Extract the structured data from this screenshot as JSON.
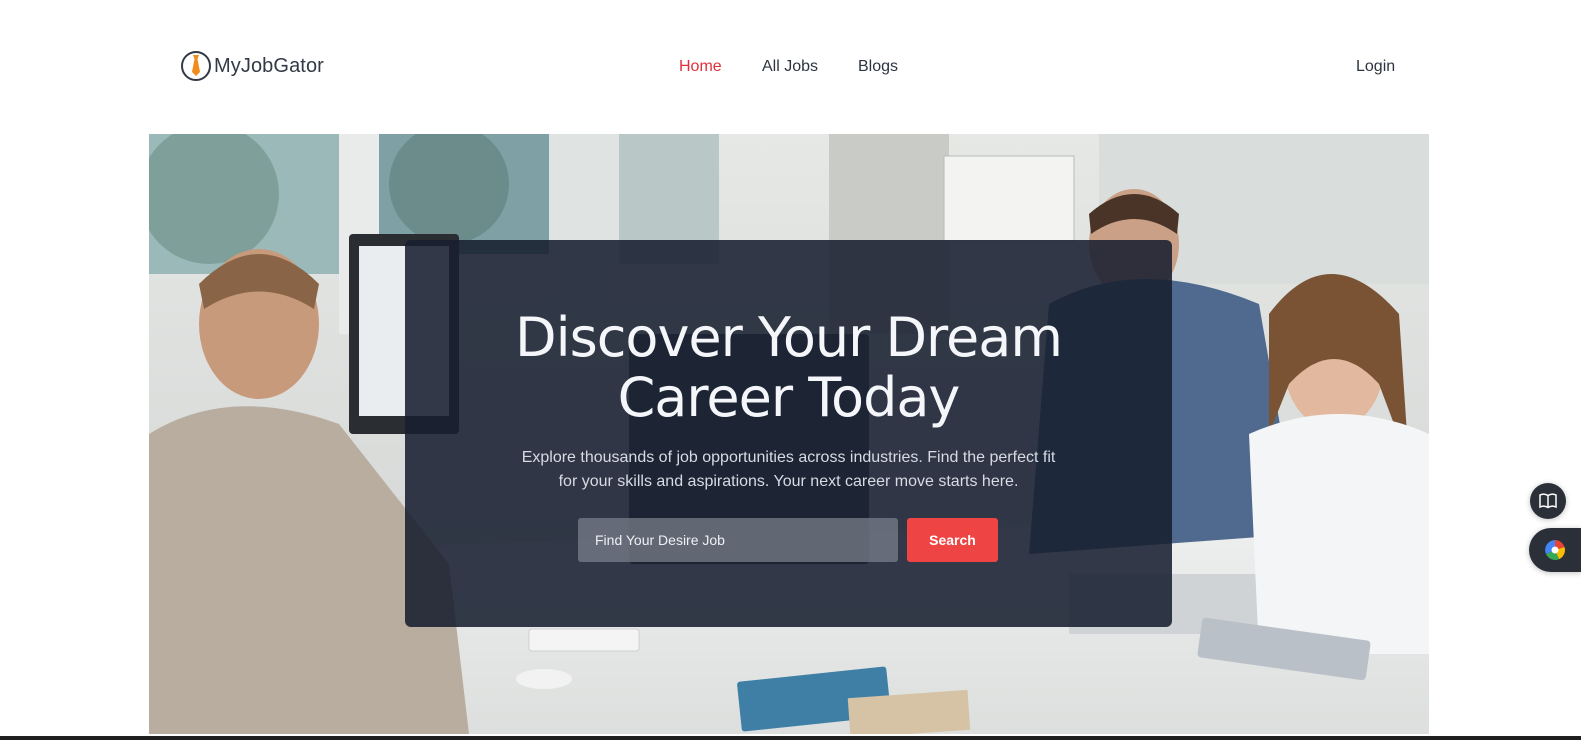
{
  "brand": {
    "name": "MyJobGator",
    "accent": "#e0313a"
  },
  "nav": {
    "items": [
      {
        "label": "Home",
        "active": true
      },
      {
        "label": "All Jobs",
        "active": false
      },
      {
        "label": "Blogs",
        "active": false
      }
    ],
    "login_label": "Login"
  },
  "hero": {
    "headline_line1": "Discover Your Dream",
    "headline_line2": "Career Today",
    "subtext_line1": "Explore thousands of job opportunities across industries. Find the perfect fit",
    "subtext_line2": "for your skills and aspirations. Your next career move starts here.",
    "background_photo": "office-team-at-desks-photo"
  },
  "search": {
    "placeholder": "Find Your Desire Job",
    "value": "",
    "button_label": "Search",
    "button_color": "#ef4444"
  },
  "floating": {
    "reader_icon": "book-icon",
    "extension_icon": "color-wheel-icon"
  }
}
